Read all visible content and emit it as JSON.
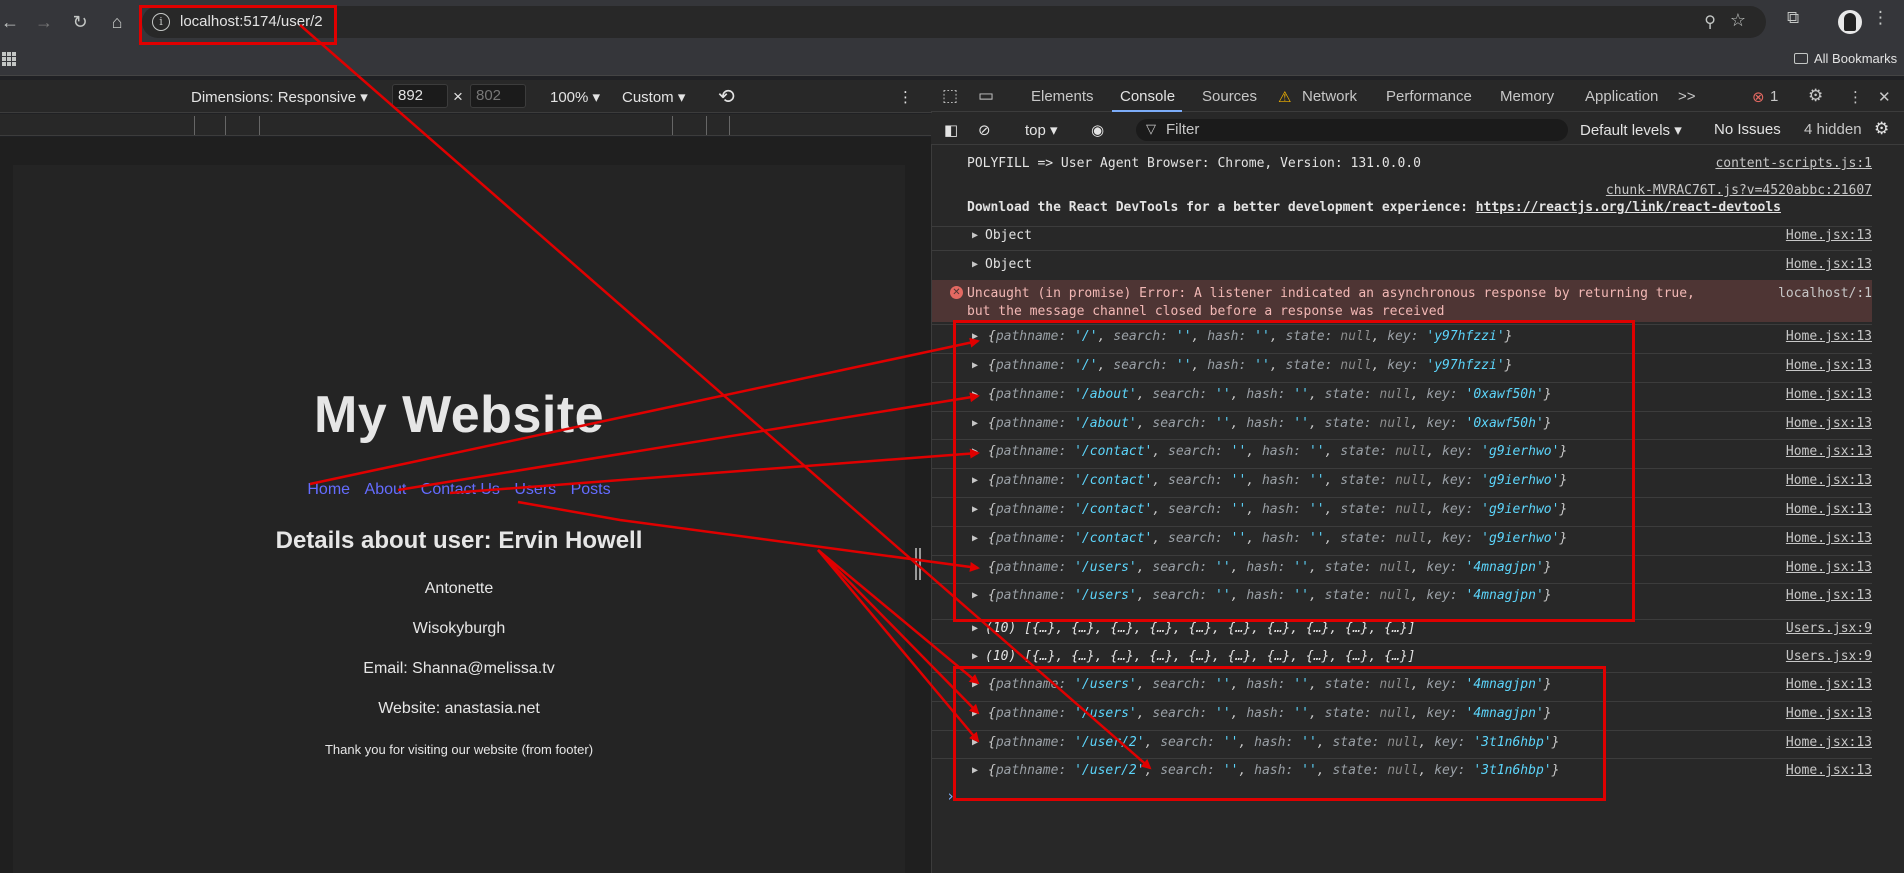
{
  "browser": {
    "url": "localhost:5174/user/2",
    "all_bookmarks_label": "All Bookmarks"
  },
  "device_toolbar": {
    "dimensions_label": "Dimensions: Responsive",
    "width_value": "892",
    "height_placeholder": "802",
    "times": "×",
    "zoom_label": "100%",
    "throttle_label": "Custom"
  },
  "website": {
    "title": "My Website",
    "nav": [
      "Home",
      "About",
      "Contact Us",
      "Users",
      "Posts"
    ],
    "user_heading": "Details about user: Ervin Howell",
    "user_lines": [
      "Antonette",
      "Wisokyburgh",
      "Email: Shanna@melissa.tv",
      "Website: anastasia.net"
    ],
    "footer": "Thank you for visiting our website (from footer)"
  },
  "devtools": {
    "tabs": [
      "Elements",
      "Console",
      "Sources",
      "Network",
      "Performance",
      "Memory",
      "Application"
    ],
    "active_tab": "Console",
    "more_tabs": ">>",
    "error_count": "1",
    "context_label": "top",
    "filter_placeholder": "Filter",
    "levels_label": "Default levels",
    "issues_label": "No Issues",
    "hidden_label": "4 hidden"
  },
  "console": {
    "polyfill_msg": "POLYFILL => User Agent Browser: Chrome, Version: 131.0.0.0",
    "polyfill_src": "content-scripts.js:1",
    "chunk_src": "chunk-MVRAC76T.js?v=4520abbc:21607",
    "react_msg": "Download the React DevTools for a better development experience: ",
    "react_link": "https://reactjs.org/link/react-devtools",
    "object_label": "Object",
    "home_src": "Home.jsx:13",
    "users_src": "Users.jsx:9",
    "error_line1": "Uncaught (in promise) Error: A listener indicated an asynchronous response by returning true,",
    "error_line2": "but the message channel closed before a response was received",
    "error_src": "localhost/:1",
    "array_msg": "(10) [{…}, {…}, {…}, {…}, {…}, {…}, {…}, {…}, {…}, {…}]",
    "locations": [
      {
        "pathname": "'/'",
        "key": "'y97hfzzi'"
      },
      {
        "pathname": "'/'",
        "key": "'y97hfzzi'"
      },
      {
        "pathname": "'/about'",
        "key": "'0xawf50h'"
      },
      {
        "pathname": "'/about'",
        "key": "'0xawf50h'"
      },
      {
        "pathname": "'/contact'",
        "key": "'g9ierhwo'"
      },
      {
        "pathname": "'/contact'",
        "key": "'g9ierhwo'"
      },
      {
        "pathname": "'/contact'",
        "key": "'g9ierhwo'"
      },
      {
        "pathname": "'/contact'",
        "key": "'g9ierhwo'"
      },
      {
        "pathname": "'/users'",
        "key": "'4mnagjpn'"
      },
      {
        "pathname": "'/users'",
        "key": "'4mnagjpn'"
      },
      {
        "pathname": "'/users'",
        "key": "'4mnagjpn'"
      },
      {
        "pathname": "'/users'",
        "key": "'4mnagjpn'"
      },
      {
        "pathname": "'/user/2'",
        "key": "'3t1n6hbp'"
      },
      {
        "pathname": "'/user/2'",
        "key": "'3t1n6hbp'"
      }
    ],
    "search_value": "''",
    "hash_value": "''",
    "state_value": "null"
  },
  "colors": {
    "annotation": "#e00000",
    "link": "#646cff",
    "string": "#5cd5fb"
  }
}
